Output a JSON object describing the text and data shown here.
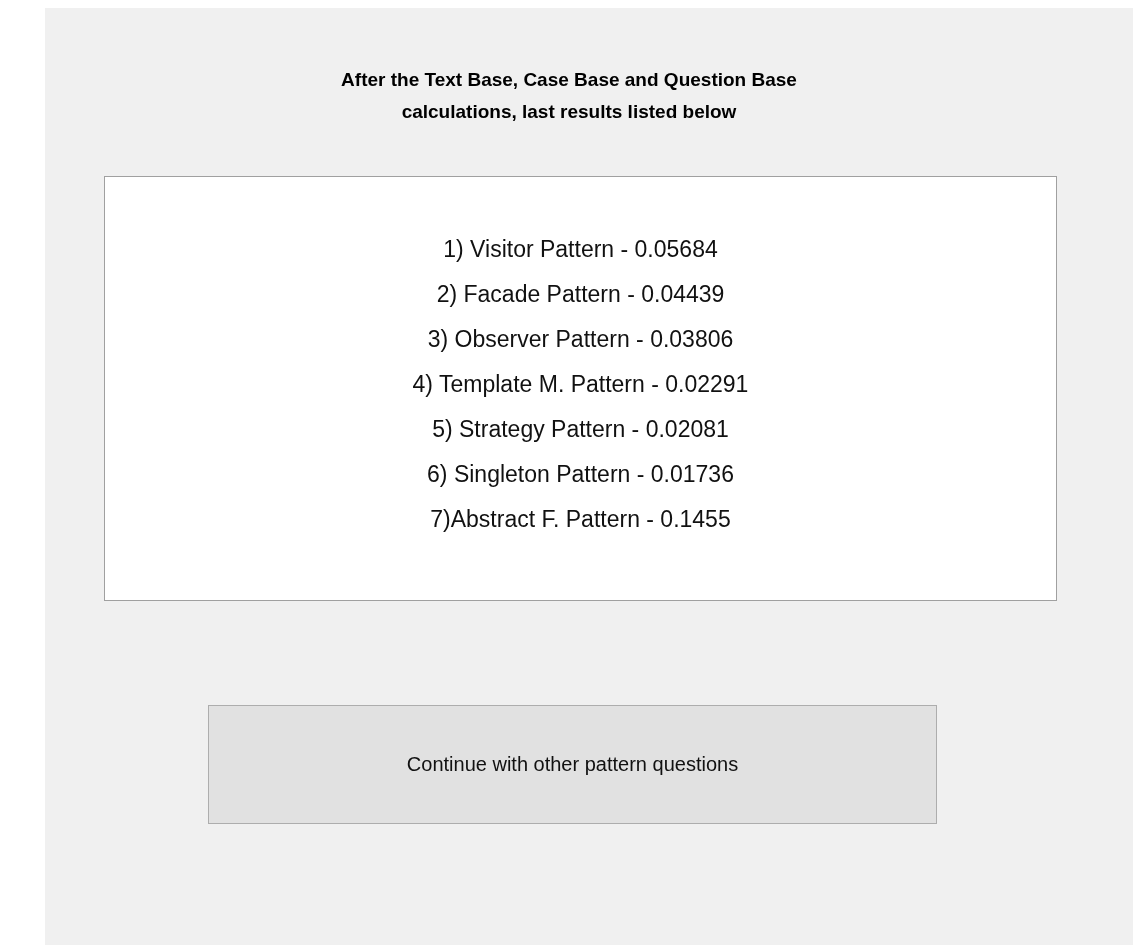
{
  "heading": "After the Text Base, Case Base and Question Base\ncalculations, last results listed below",
  "results": [
    "1) Visitor Pattern - 0.05684",
    "2) Facade Pattern - 0.04439",
    "3) Observer Pattern - 0.03806",
    "4) Template M. Pattern - 0.02291",
    "5) Strategy Pattern - 0.02081",
    "6) Singleton Pattern - 0.01736",
    "7)Abstract F. Pattern - 0.1455"
  ],
  "buttons": [
    "Continue with other pattern questions"
  ]
}
